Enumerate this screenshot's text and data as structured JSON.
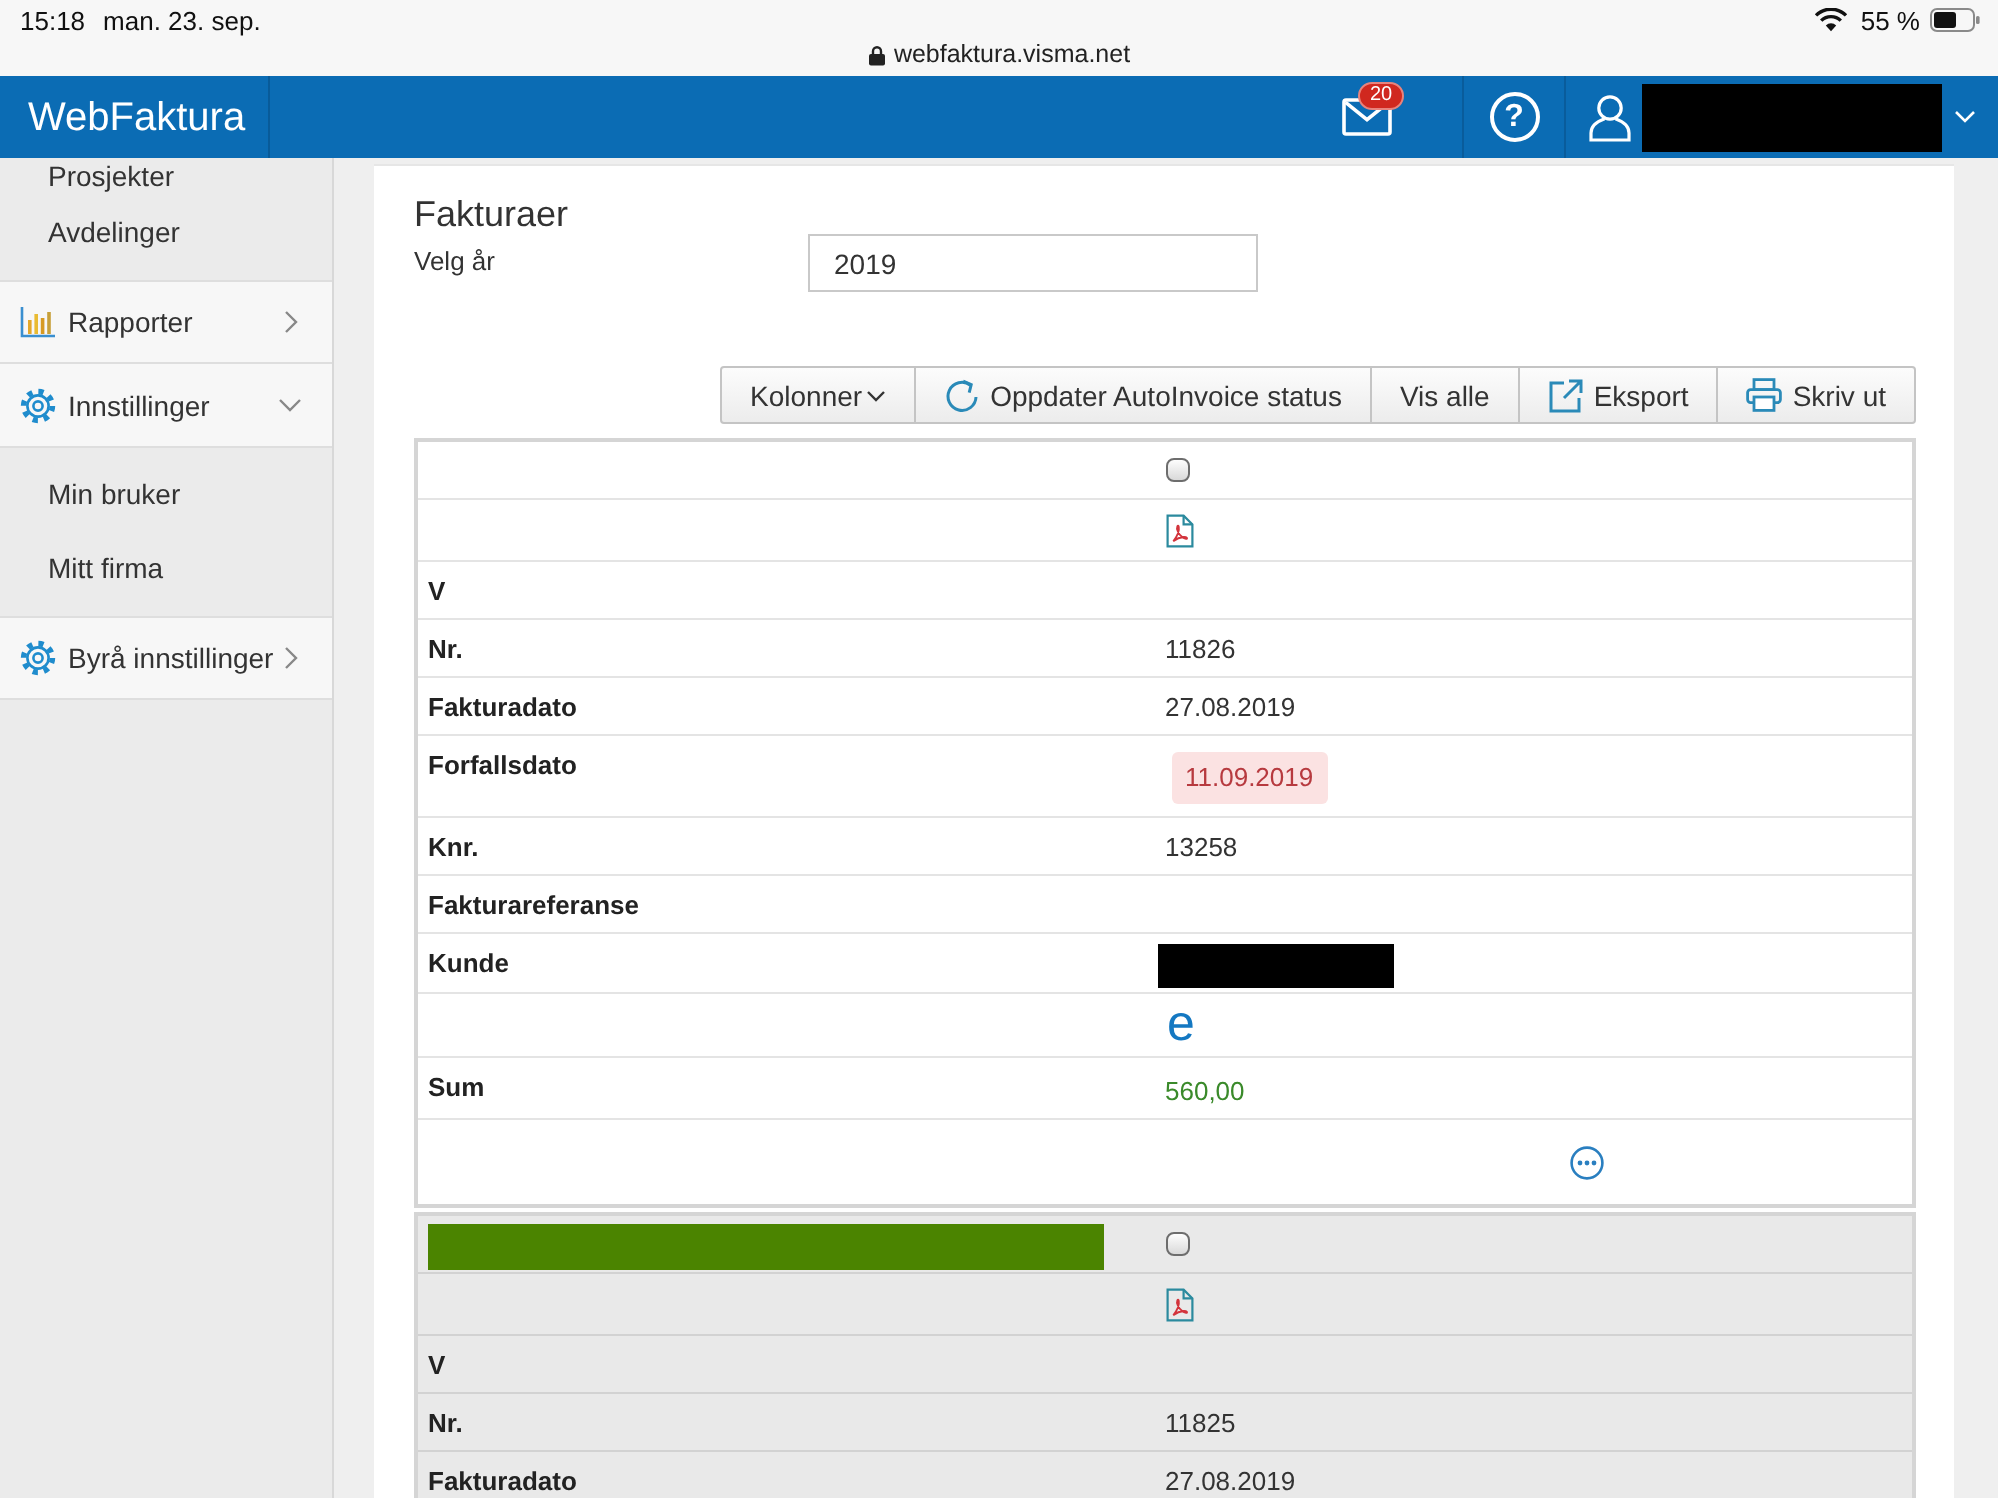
{
  "status_bar": {
    "time": "15:18",
    "date": "man. 23. sep.",
    "url": "webfaktura.visma.net",
    "battery": "55 %"
  },
  "header": {
    "title": "WebFaktura",
    "message_count": "20",
    "help_symbol": "?"
  },
  "sidebar": {
    "items": [
      {
        "kind": "item",
        "label": "Prosjekter"
      },
      {
        "kind": "item",
        "label": "Avdelinger"
      },
      {
        "kind": "reports",
        "label": "Rapporter",
        "expanded": false
      },
      {
        "kind": "settings",
        "label": "Innstillinger",
        "expanded": true
      },
      {
        "kind": "item",
        "label": "Min bruker"
      },
      {
        "kind": "item",
        "label": "Mitt firma"
      },
      {
        "kind": "settings",
        "label": "Byrå innstillinger",
        "expanded": false
      }
    ]
  },
  "page": {
    "title": "Fakturaer",
    "year_label": "Velg år",
    "year_value": "2019"
  },
  "toolbar": [
    {
      "kind": "dropdown",
      "label": "Kolonner"
    },
    {
      "kind": "refresh",
      "label": "Oppdater AutoInvoice status"
    },
    {
      "kind": "plain",
      "label": "Vis alle"
    },
    {
      "kind": "export",
      "label": "Eksport"
    },
    {
      "kind": "print",
      "label": "Skriv ut"
    }
  ],
  "invoices": [
    {
      "marked": false,
      "rows": [
        {
          "kind": "checkbox",
          "checked": false
        },
        {
          "kind": "pdf"
        },
        {
          "kind": "text",
          "label": "V"
        },
        {
          "kind": "text",
          "label": "Nr.",
          "value": "11826"
        },
        {
          "kind": "text",
          "label": "Fakturadato",
          "value": "27.08.2019"
        },
        {
          "kind": "due",
          "label": "Forfallsdato",
          "value": "11.09.2019",
          "overdue": true
        },
        {
          "kind": "text",
          "label": "Knr.",
          "value": "13258"
        },
        {
          "kind": "text",
          "label": "Fakturareferanse"
        },
        {
          "kind": "redacted",
          "label": "Kunde"
        },
        {
          "kind": "einvoice",
          "value": "e"
        },
        {
          "kind": "amount",
          "label": "Sum",
          "value": "560,00"
        },
        {
          "kind": "actions"
        }
      ]
    },
    {
      "marked": true,
      "rows": [
        {
          "kind": "checkbox",
          "checked": false
        },
        {
          "kind": "pdf"
        },
        {
          "kind": "text",
          "label": "V"
        },
        {
          "kind": "text",
          "label": "Nr.",
          "value": "11825"
        },
        {
          "kind": "text",
          "label": "Fakturadato",
          "value": "27.08.2019"
        }
      ]
    }
  ]
}
